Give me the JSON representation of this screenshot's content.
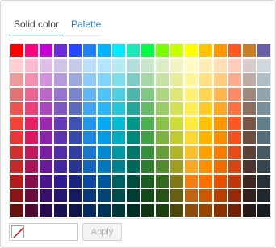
{
  "tabs": [
    {
      "label": "Solid color",
      "active": true
    },
    {
      "label": "Palette",
      "active": false
    }
  ],
  "apply_label": "Apply",
  "preview_icon": "no-color-icon",
  "colors": {
    "accent": "#1f6fb2",
    "link": "#2d7dc2",
    "no_color_slash": "#d11f1f"
  },
  "palette": [
    [
      "#ff0000",
      "#ff0080",
      "#c800d8",
      "#6b2ddc",
      "#2748ff",
      "#1f7fff",
      "#00b4ff",
      "#00ecff",
      "#1de9b6",
      "#00ff44",
      "#76ff03",
      "#c6ff00",
      "#ffff00",
      "#ffc400",
      "#ff9800",
      "#ff5722",
      "#c97d26",
      "#6a5fa6"
    ],
    [
      "#ffcdd2",
      "#f8bbd0",
      "#e1bee7",
      "#d1c4e9",
      "#c5cae9",
      "#bbdefb",
      "#b3e5fc",
      "#b2ebf2",
      "#b2dfdb",
      "#c8e6c9",
      "#dcedc8",
      "#f0f4c3",
      "#fff9c4",
      "#ffecb3",
      "#ffe0b2",
      "#ffccbc",
      "#d7ccc8",
      "#cfd8dc"
    ],
    [
      "#ef9a9a",
      "#f48fb1",
      "#ce93d8",
      "#b39ddb",
      "#9fa8da",
      "#90caf9",
      "#81d4fa",
      "#80deea",
      "#80cbc4",
      "#a5d6a7",
      "#c5e1a5",
      "#e6ee9c",
      "#fff59d",
      "#ffe082",
      "#ffcc80",
      "#ffab91",
      "#bcaaa4",
      "#b0bec5"
    ],
    [
      "#e57373",
      "#f06292",
      "#ba68c8",
      "#9575cd",
      "#7986cb",
      "#64b5f6",
      "#4fc3f7",
      "#4dd0e1",
      "#4db6ac",
      "#81c784",
      "#aed581",
      "#dce775",
      "#fff176",
      "#ffd54f",
      "#ffb74d",
      "#ff8a65",
      "#a1887f",
      "#90a4ae"
    ],
    [
      "#ef5350",
      "#ec407a",
      "#ab47bc",
      "#7e57c2",
      "#5c6bc0",
      "#42a5f5",
      "#29b6f6",
      "#26c6da",
      "#26a69a",
      "#66bb6a",
      "#9ccc65",
      "#d4e157",
      "#ffee58",
      "#ffca28",
      "#ffa726",
      "#ff7043",
      "#8d6e63",
      "#78909c"
    ],
    [
      "#f44336",
      "#e91e63",
      "#9c27b0",
      "#673ab7",
      "#3f51b5",
      "#2196f3",
      "#03a9f4",
      "#00bcd4",
      "#009688",
      "#4caf50",
      "#8bc34a",
      "#cddc39",
      "#ffeb3b",
      "#ffc107",
      "#ff9800",
      "#ff5722",
      "#795548",
      "#607d8b"
    ],
    [
      "#e53935",
      "#d81b60",
      "#8e24aa",
      "#5e35b1",
      "#3949ab",
      "#1e88e5",
      "#039be5",
      "#00acc1",
      "#00897b",
      "#43a047",
      "#7cb342",
      "#c0ca33",
      "#fdd835",
      "#ffb300",
      "#fb8c00",
      "#f4511e",
      "#6d4c41",
      "#546e7a"
    ],
    [
      "#d32f2f",
      "#c2185b",
      "#7b1fa2",
      "#512da8",
      "#303f9f",
      "#1976d2",
      "#0288d1",
      "#0097a7",
      "#00796b",
      "#388e3c",
      "#689f38",
      "#afb42b",
      "#fbc02d",
      "#ffa000",
      "#f57c00",
      "#e64a19",
      "#5d4037",
      "#455a64"
    ],
    [
      "#c62828",
      "#ad1457",
      "#6a1b9a",
      "#4527a0",
      "#283593",
      "#1565c0",
      "#0277bd",
      "#00838f",
      "#00695c",
      "#2e7d32",
      "#558b2f",
      "#9e9d24",
      "#f9a825",
      "#ff8f00",
      "#ef6c00",
      "#d84315",
      "#4e342e",
      "#37474f"
    ],
    [
      "#b71c1c",
      "#880e4f",
      "#4a148c",
      "#311b92",
      "#1a237e",
      "#0d47a1",
      "#01579b",
      "#006064",
      "#004d40",
      "#1b5e20",
      "#33691e",
      "#827717",
      "#f57f17",
      "#ff6f00",
      "#e65100",
      "#bf360c",
      "#3e2723",
      "#263238"
    ],
    [
      "#8e1515",
      "#6b0b3e",
      "#3a0f6e",
      "#261572",
      "#141b63",
      "#0a3880",
      "#01457a",
      "#004c4f",
      "#003d33",
      "#154a19",
      "#28531a",
      "#676012",
      "#c26512",
      "#cc5900",
      "#b84100",
      "#982b0a",
      "#31201c",
      "#1e282d"
    ],
    [
      "#671010",
      "#4f082e",
      "#2a0b51",
      "#1c1055",
      "#0f1449",
      "#072a5f",
      "#01335a",
      "#00383a",
      "#002d26",
      "#0f3712",
      "#1d3d13",
      "#4c470d",
      "#8f4b0e",
      "#994300",
      "#8a3100",
      "#722008",
      "#251815",
      "#161e22"
    ]
  ]
}
